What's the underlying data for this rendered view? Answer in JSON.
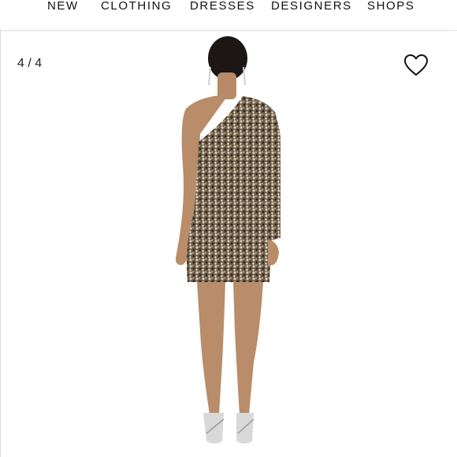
{
  "nav": {
    "items": [
      {
        "label": "NEW"
      },
      {
        "label": "CLOTHING"
      },
      {
        "label": "DRESSES"
      },
      {
        "label": "DESIGNERS"
      },
      {
        "label": "SHOPS"
      }
    ]
  },
  "gallery": {
    "counter": "4 / 4",
    "favorite_icon": "heart-outline-icon"
  },
  "colors": {
    "background": "#ffffff",
    "text": "#111111",
    "divider": "#e2e2e2"
  }
}
